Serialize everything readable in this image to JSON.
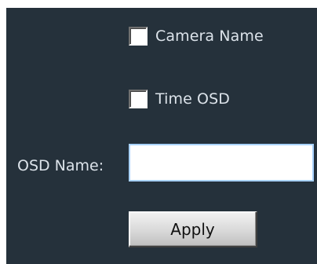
{
  "options": {
    "camera_name_label": "Camera Name",
    "time_osd_label": "Time OSD"
  },
  "osd": {
    "field_label": "OSD Name:",
    "value": ""
  },
  "actions": {
    "apply_label": "Apply"
  },
  "colors": {
    "panel_background": "#25313b",
    "text": "#dce3ea",
    "input_border": "#a9d2ff"
  }
}
